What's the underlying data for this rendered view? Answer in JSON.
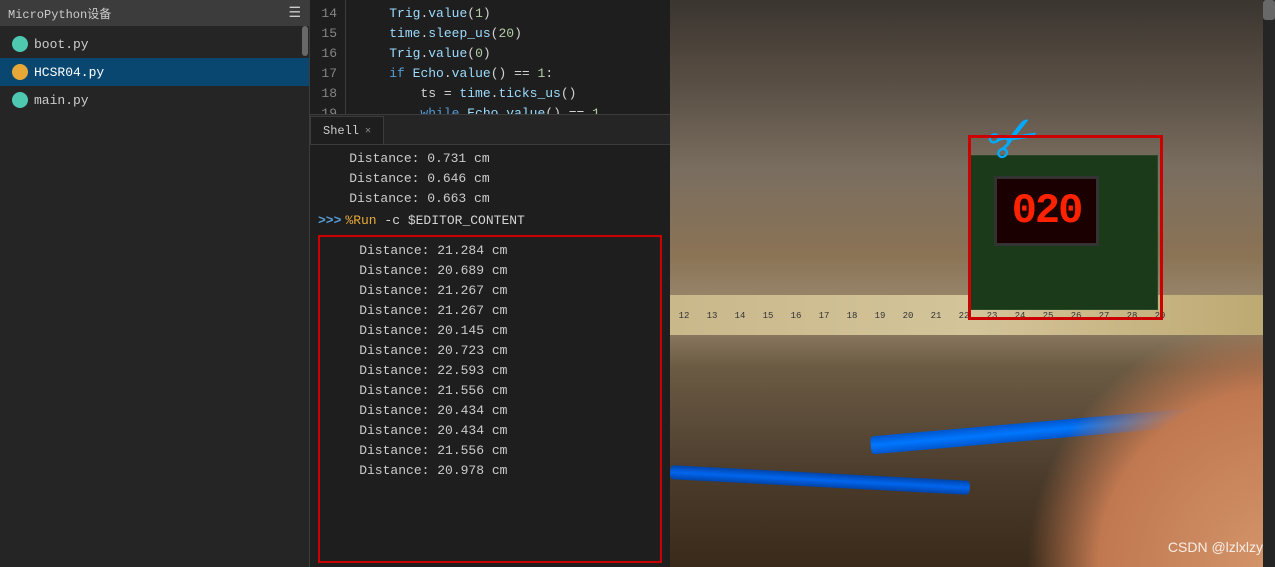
{
  "sidebar": {
    "title": "MicroPython设备",
    "files": [
      {
        "name": "boot.py",
        "iconColor": "green",
        "active": false
      },
      {
        "name": "HCSR04.py",
        "iconColor": "orange",
        "active": true
      },
      {
        "name": "main.py",
        "iconColor": "green",
        "active": false
      }
    ]
  },
  "editor": {
    "lines": [
      {
        "num": "14",
        "code": "    Trig.value(1)"
      },
      {
        "num": "15",
        "code": "    time.sleep_us(20)"
      },
      {
        "num": "16",
        "code": "    Trig.value(0)"
      },
      {
        "num": "17",
        "code": "    if Echo.value() == 1:"
      },
      {
        "num": "18",
        "code": "        ts = time.ticks_us()"
      },
      {
        "num": "19",
        "code": "        while Echo.value() == 1"
      }
    ]
  },
  "shell": {
    "tab_label": "Shell",
    "pre_output": [
      "    Distance: 0.731 cm",
      "    Distance: 0.646 cm",
      "    Distance: 0.663 cm"
    ],
    "command_prompt": ">>>",
    "command": " %Run -c $EDITOR_CONTENT",
    "output_lines": [
      "    Distance: 21.284 cm",
      "    Distance: 20.689 cm",
      "    Distance: 21.267 cm",
      "    Distance: 21.267 cm",
      "    Distance: 20.145 cm",
      "    Distance: 20.723 cm",
      "    Distance: 22.593 cm",
      "    Distance: 21.556 cm",
      "    Distance: 20.434 cm",
      "    Distance: 20.434 cm",
      "    Distance: 21.556 cm",
      "    Distance: 20.978 cm"
    ]
  },
  "image": {
    "led_display": "020",
    "watermark": "CSDN @lzlxlzy"
  }
}
